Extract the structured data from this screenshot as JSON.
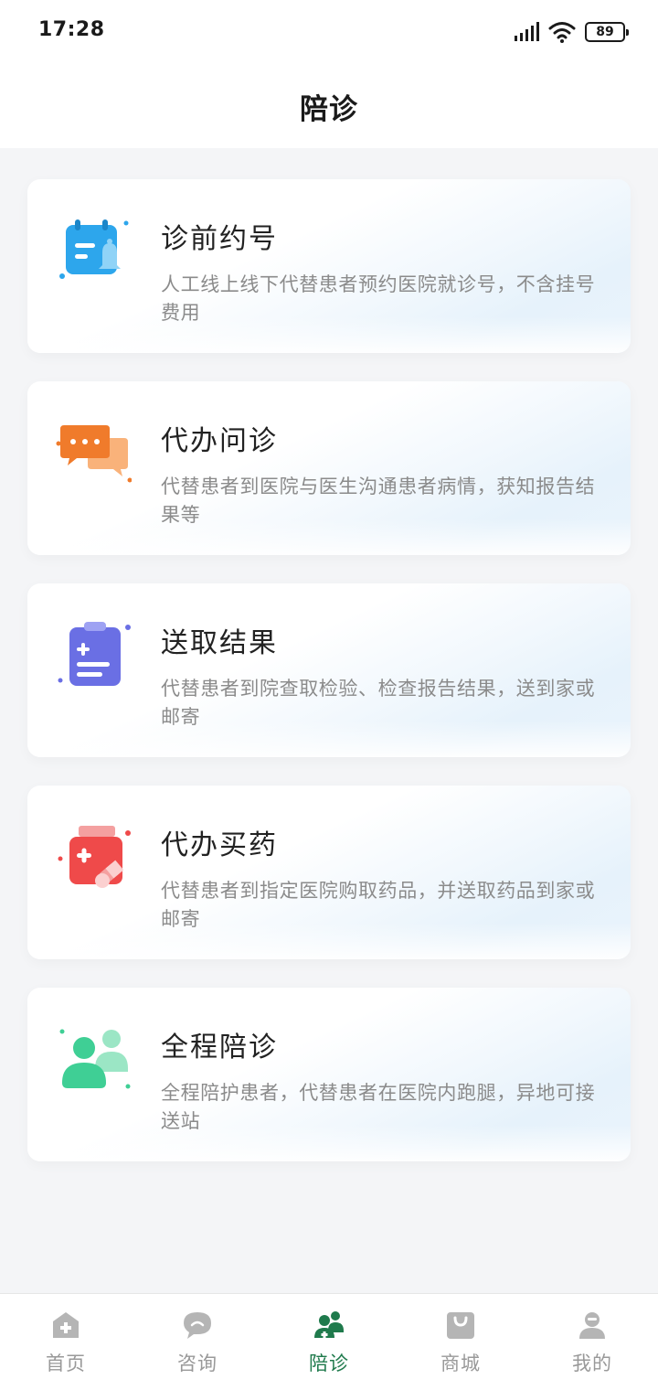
{
  "status_bar": {
    "time": "17:28",
    "battery_level": "89"
  },
  "header": {
    "title": "陪诊"
  },
  "services": [
    {
      "title": "诊前约号",
      "description": "人工线上线下代替患者预约医院就诊号，不含挂号费用",
      "icon": "calendar-bell-icon",
      "color": "#2da6ec"
    },
    {
      "title": "代办问诊",
      "description": "代替患者到医院与医生沟通患者病情，获知报告结果等",
      "icon": "chat-bubbles-icon",
      "color": "#f07b2b"
    },
    {
      "title": "送取结果",
      "description": "代替患者到院查取检验、检查报告结果，送到家或邮寄",
      "icon": "clipboard-report-icon",
      "color": "#6a6fe4"
    },
    {
      "title": "代办买药",
      "description": "代替患者到指定医院购取药品，并送取药品到家或邮寄",
      "icon": "medicine-bottle-icon",
      "color": "#ef4a4a"
    },
    {
      "title": "全程陪诊",
      "description": "全程陪护患者，代替患者在医院内跑腿，异地可接送站",
      "icon": "people-icon",
      "color": "#3fcf95"
    }
  ],
  "tab_bar": {
    "active_color": "#1f7a4c",
    "inactive_color": "#999999",
    "items": [
      {
        "label": "首页",
        "icon": "home-icon",
        "active": false
      },
      {
        "label": "咨询",
        "icon": "chat-icon",
        "active": false
      },
      {
        "label": "陪诊",
        "icon": "accompany-icon",
        "active": true
      },
      {
        "label": "商城",
        "icon": "shop-bag-icon",
        "active": false
      },
      {
        "label": "我的",
        "icon": "profile-icon",
        "active": false
      }
    ]
  }
}
